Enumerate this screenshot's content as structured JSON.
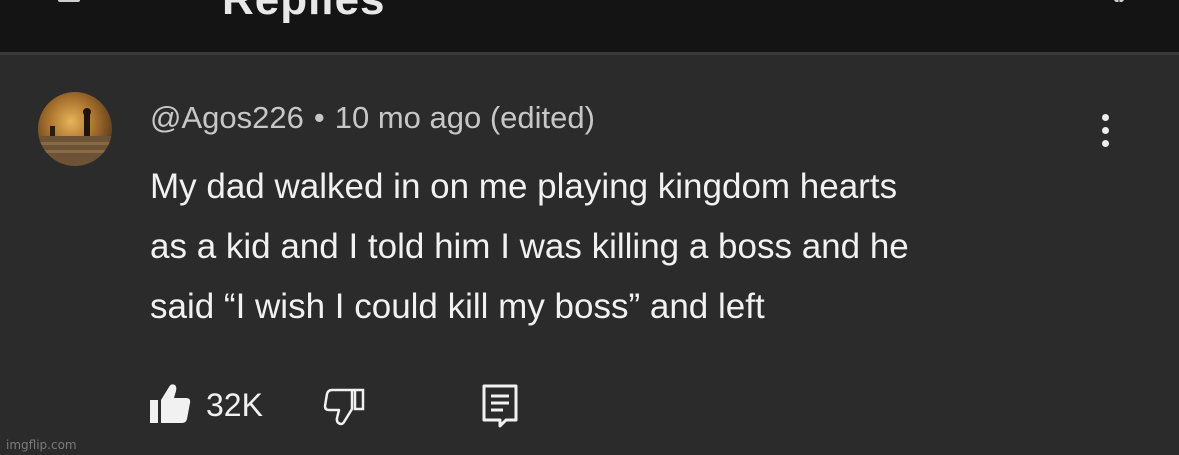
{
  "header": {
    "title": "Replies"
  },
  "comment": {
    "author": "@Agos226",
    "separator": "•",
    "timestamp": "10 mo ago (edited)",
    "text_lines": [
      "My dad walked in on me playing kingdom hearts",
      "as a kid and I told him I was killing a boss and he",
      "said “I wish I could kill my boss” and left"
    ],
    "likes": "32K",
    "icons": {
      "like": "thumbs-up-filled-icon",
      "dislike": "thumbs-down-outline-icon",
      "reply": "reply-comment-icon",
      "more": "vertical-ellipsis-icon"
    }
  },
  "watermark": "imgflip.com",
  "colors": {
    "background": "#2b2b2b",
    "topbar": "#141414",
    "text_primary": "#f1f1f1",
    "text_secondary": "#c7c7c7"
  }
}
